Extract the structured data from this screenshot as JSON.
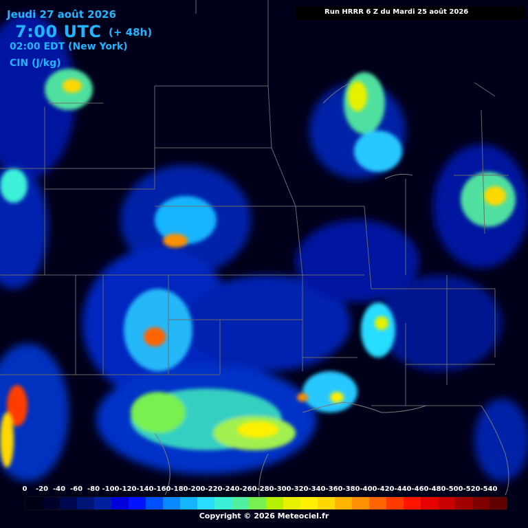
{
  "header": {
    "date": "Jeudi 27 août 2026",
    "utc_time": "7:00 UTC",
    "lead_time": "(+ 48h)",
    "local_time": "02:00 EDT (New York)",
    "variable": "CIN (J/kg)",
    "run_info": "Run HRRR 6 Z du Mardi 25 août 2026"
  },
  "legend": {
    "labels": [
      "0",
      "-20",
      "-40",
      "-60",
      "-80",
      "-100",
      "-120",
      "-140",
      "-160",
      "-180",
      "-200",
      "-220",
      "-240",
      "-260",
      "-280",
      "-300",
      "-320",
      "-340",
      "-360",
      "-380",
      "-400",
      "-420",
      "-440",
      "-460",
      "-480",
      "-500",
      "-520",
      "-540"
    ],
    "colors": [
      "#000014",
      "#00002c",
      "#000850",
      "#001478",
      "#0020a0",
      "#0000d8",
      "#0014ff",
      "#0050ff",
      "#0a88ff",
      "#14b4ff",
      "#28dcff",
      "#3cf0d8",
      "#50f0a0",
      "#78f050",
      "#b4f000",
      "#e6f000",
      "#fff000",
      "#ffd800",
      "#ffb400",
      "#ff9000",
      "#ff6400",
      "#ff3c00",
      "#ff1400",
      "#e60000",
      "#c80000",
      "#a00000",
      "#800000",
      "#600000"
    ]
  },
  "copyright": "Copyright © 2026 Meteociel.fr"
}
